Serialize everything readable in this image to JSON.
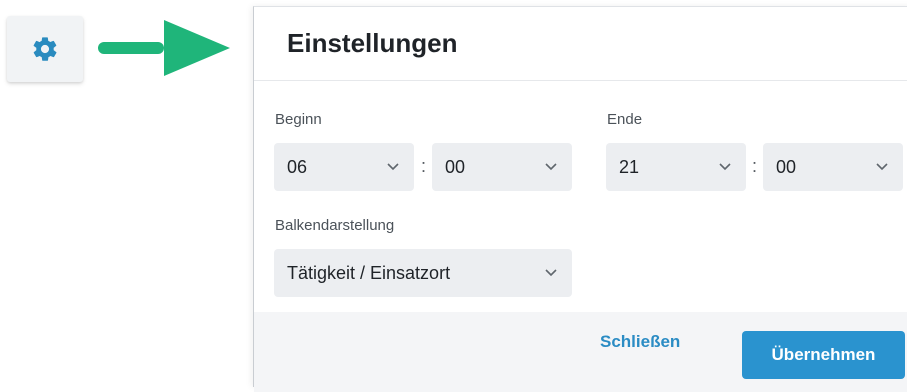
{
  "gear_button": {
    "icon": "gear-icon",
    "color": "#2a8bbf"
  },
  "arrow": {
    "icon": "arrow-right-icon",
    "color": "#1fb57a"
  },
  "dialog": {
    "title": "Einstellungen",
    "begin": {
      "label": "Beginn",
      "hour": "06",
      "minute": "00",
      "separator": ":"
    },
    "end": {
      "label": "Ende",
      "hour": "21",
      "minute": "00",
      "separator": ":"
    },
    "bar_display": {
      "label": "Balkendarstellung",
      "value": "Tätigkeit / Einsatzort"
    },
    "footer": {
      "close_label": "Schließen",
      "apply_label": "Übernehmen",
      "accent": "#2a93cf"
    }
  }
}
